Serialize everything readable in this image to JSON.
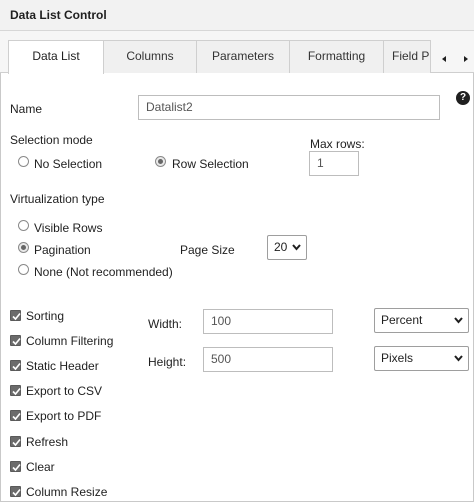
{
  "window": {
    "title": "Data List Control"
  },
  "tabs": [
    {
      "label": "Data List",
      "active": true
    },
    {
      "label": "Columns",
      "active": false
    },
    {
      "label": "Parameters",
      "active": false
    },
    {
      "label": "Formatting",
      "active": false
    },
    {
      "label": "Field P",
      "active": false
    }
  ],
  "icons": {
    "help": "?",
    "tab_scroll_left": "caret-left-icon",
    "tab_scroll_right": "caret-right-icon"
  },
  "name": {
    "label": "Name",
    "value": "Datalist2"
  },
  "selection_mode": {
    "label": "Selection mode",
    "options": [
      {
        "label": "No Selection",
        "selected": false
      },
      {
        "label": "Row Selection",
        "selected": true
      }
    ],
    "max_rows": {
      "label": "Max rows:",
      "value": "1"
    }
  },
  "virtualization": {
    "label": "Virtualization type",
    "options": [
      {
        "label": "Visible Rows",
        "selected": false
      },
      {
        "label": "Pagination",
        "selected": true
      },
      {
        "label": "None (Not recommended)",
        "selected": false
      }
    ],
    "page_size": {
      "label": "Page Size",
      "value": "20"
    }
  },
  "features": [
    {
      "label": "Sorting",
      "checked": true
    },
    {
      "label": "Column Filtering",
      "checked": true
    },
    {
      "label": "Static Header",
      "checked": true
    },
    {
      "label": "Export to CSV",
      "checked": true
    },
    {
      "label": "Export to PDF",
      "checked": true
    },
    {
      "label": "Refresh",
      "checked": true
    },
    {
      "label": "Clear",
      "checked": true
    },
    {
      "label": "Column Resize",
      "checked": true
    }
  ],
  "dimensions": {
    "width": {
      "label": "Width:",
      "value": "100",
      "unit": "Percent"
    },
    "height": {
      "label": "Height:",
      "value": "500",
      "unit": "Pixels"
    }
  }
}
